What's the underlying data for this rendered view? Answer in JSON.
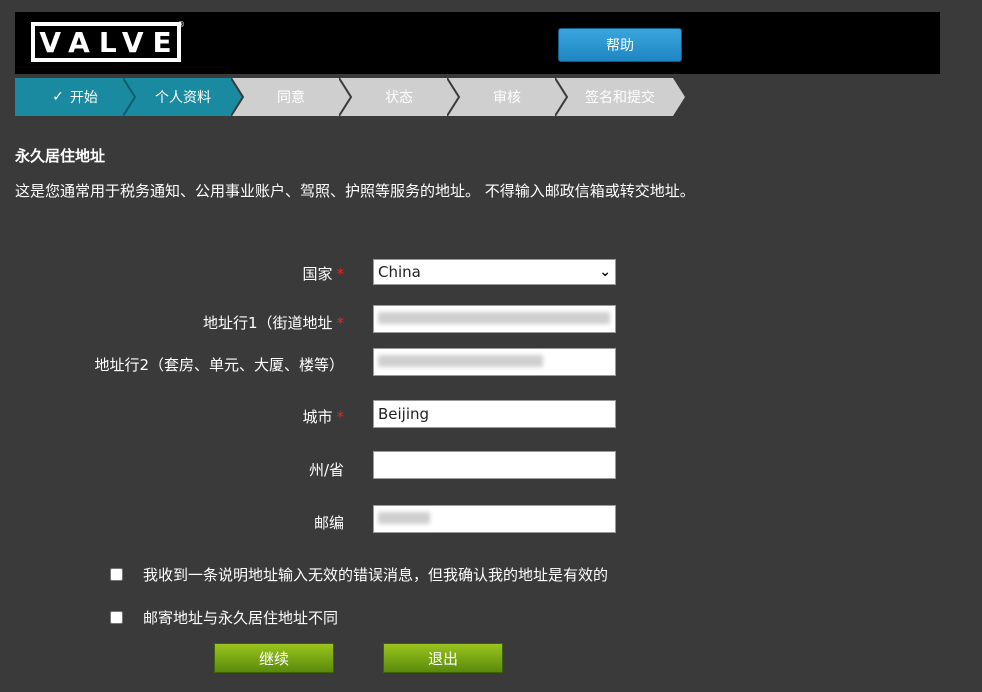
{
  "header": {
    "logo_text": "VALVE",
    "logo_tm": "®",
    "help_label": "帮助"
  },
  "steps": [
    {
      "label": "开始",
      "state": "done",
      "icon": "check-icon"
    },
    {
      "label": "个人资料",
      "state": "active"
    },
    {
      "label": "同意",
      "state": "inactive"
    },
    {
      "label": "状态",
      "state": "inactive"
    },
    {
      "label": "审核",
      "state": "inactive"
    },
    {
      "label": "签名和提交",
      "state": "inactive"
    }
  ],
  "section": {
    "title": "永久居住地址",
    "description": "这是您通常用于税务通知、公用事业账户、驾照、护照等服务的地址。 不得输入邮政信箱或转交地址。"
  },
  "form": {
    "country": {
      "label": "国家",
      "required": "*",
      "value": "China"
    },
    "address1": {
      "label": "地址行1（街道地址",
      "required": "*",
      "value": ""
    },
    "address2": {
      "label": "地址行2（套房、单元、大厦、楼等）",
      "value": ""
    },
    "city": {
      "label": "城市",
      "required": "*",
      "value": "Beijing"
    },
    "state": {
      "label": "州/省",
      "value": ""
    },
    "postal": {
      "label": "邮编",
      "value": ""
    }
  },
  "checkboxes": {
    "invalid_confirm": "我收到一条说明地址输入无效的错误消息，但我确认我的地址是有效的",
    "mailing_different": "邮寄地址与永久居住地址不同"
  },
  "buttons": {
    "continue": "继续",
    "exit": "退出"
  },
  "colors": {
    "step_active": "#1a8aa0",
    "step_inactive": "#cfcfcf",
    "help_button": "#2a96d0",
    "green_button": "#7aa816",
    "required": "#d82a2a"
  }
}
